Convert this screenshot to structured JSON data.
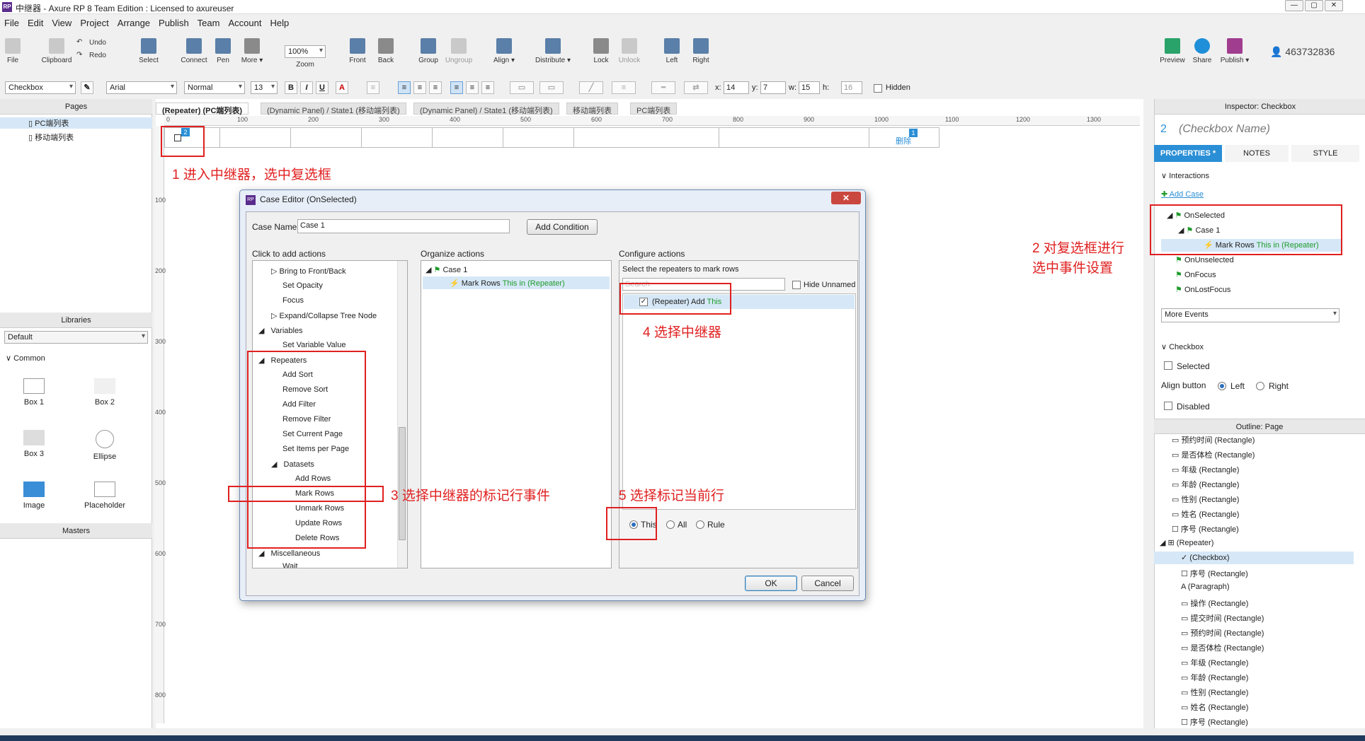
{
  "window": {
    "title": "中继器 - Axure RP 8 Team Edition : Licensed to axureuser",
    "logo": "RP"
  },
  "menu": [
    "File",
    "Edit",
    "View",
    "Project",
    "Arrange",
    "Publish",
    "Team",
    "Account",
    "Help"
  ],
  "toolbar": {
    "file": "File",
    "clipboard": "Clipboard",
    "undo": "Undo",
    "redo": "Redo",
    "select": "Select",
    "connect": "Connect",
    "pen": "Pen",
    "more": "More ▾",
    "zoom_value": "100%",
    "zoom": "Zoom",
    "front": "Front",
    "back": "Back",
    "group": "Group",
    "ungroup": "Ungroup",
    "align": "Align ▾",
    "distribute": "Distribute ▾",
    "lock": "Lock",
    "unlock": "Unlock",
    "left": "Left",
    "right": "Right",
    "preview": "Preview",
    "share": "Share",
    "publish": "Publish ▾",
    "user": "463732836"
  },
  "format": {
    "widget_type": "Checkbox",
    "font": "Arial",
    "weight": "Normal",
    "size": "13",
    "bold": "B",
    "italic": "I",
    "underline": "U",
    "x_label": "x:",
    "x": "14",
    "y_label": "y:",
    "y": "7",
    "w_label": "w:",
    "w": "15",
    "h_label": "h:",
    "h": "16",
    "hidden": "Hidden"
  },
  "pages_panel": {
    "title": "Pages",
    "items": [
      "PC端列表",
      "移动端列表"
    ]
  },
  "libraries": {
    "title": "Libraries",
    "selected": "Default",
    "group": "Common",
    "items": [
      "Box 1",
      "Box 2",
      "Box 3",
      "Ellipse",
      "Image",
      "Placeholder"
    ]
  },
  "masters": {
    "title": "Masters"
  },
  "tabs": [
    "(Repeater) (PC端列表)",
    "(Dynamic Panel) / State1 (移动端列表)",
    "(Dynamic Panel) / State1 (移动端列表)",
    "移动端列表",
    "PC端列表"
  ],
  "ruler_h": [
    "0",
    "100",
    "200",
    "300",
    "400",
    "500",
    "600",
    "700",
    "800",
    "900",
    "1000",
    "1100",
    "1200",
    "1300"
  ],
  "ruler_v": [
    "100",
    "200",
    "300",
    "400",
    "500",
    "600",
    "700",
    "800"
  ],
  "canvas": {
    "badge1": "2",
    "badge2": "1",
    "delete_text": "删除"
  },
  "annotations": {
    "a1": "1 进入中继器，选中复选框",
    "a2_line1": "2 对复选框进行",
    "a2_line2": "选中事件设置",
    "a3": "3 选择中继器的标记行事件",
    "a4": "4 选择中继器",
    "a5": "5 选择标记当前行"
  },
  "dialog": {
    "title": "Case Editor (OnSelected)",
    "close": "✕",
    "case_name_label": "Case Name",
    "case_name": "Case 1",
    "add_condition": "Add Condition",
    "col1_title": "Click to add actions",
    "col2_title": "Organize actions",
    "col3_title": "Configure actions",
    "actions": [
      "Bring to Front/Back",
      "Set Opacity",
      "Focus",
      "Expand/Collapse Tree Node",
      "Variables",
      "Set Variable Value",
      "Repeaters",
      "Add Sort",
      "Remove Sort",
      "Add Filter",
      "Remove Filter",
      "Set Current Page",
      "Set Items per Page",
      "Datasets",
      "Add Rows",
      "Mark Rows",
      "Unmark Rows",
      "Update Rows",
      "Delete Rows",
      "Miscellaneous",
      "Wait"
    ],
    "organize": {
      "case": "Case 1",
      "action": "Mark Rows",
      "action_green": "This in (Repeater)"
    },
    "configure": {
      "label": "Select the repeaters to mark rows",
      "search_placeholder": "Search",
      "hide_unnamed": "Hide Unnamed",
      "repeater_item": "(Repeater) Add",
      "repeater_green": "This",
      "opt_this": "This",
      "opt_all": "All",
      "opt_rule": "Rule"
    },
    "ok": "OK",
    "cancel": "Cancel"
  },
  "inspector": {
    "title": "Inspector: Checkbox",
    "number": "2",
    "name_placeholder": "(Checkbox Name)",
    "tabs": [
      "PROPERTIES",
      "NOTES",
      "STYLE"
    ],
    "interactions": "Interactions",
    "add_case": "Add Case",
    "events": [
      "OnSelected",
      "Case 1",
      "OnUnselected",
      "OnFocus",
      "OnLostFocus"
    ],
    "mark_rows": "Mark Rows",
    "mark_rows_green": "This in (Repeater)",
    "more_events": "More Events",
    "checkbox_section": "Checkbox",
    "selected": "Selected",
    "align_button": "Align button",
    "left": "Left",
    "right": "Right",
    "disabled": "Disabled"
  },
  "outline": {
    "title": "Outline: Page",
    "items": [
      "预约时间 (Rectangle)",
      "是否体检 (Rectangle)",
      "年级 (Rectangle)",
      "年龄 (Rectangle)",
      "性别 (Rectangle)",
      "姓名 (Rectangle)",
      "序号 (Rectangle)",
      "(Repeater)",
      "(Checkbox)",
      "序号 (Rectangle)",
      "(Paragraph)",
      "操作 (Rectangle)",
      "提交时间 (Rectangle)",
      "预约时间 (Rectangle)",
      "是否体检 (Rectangle)",
      "年级 (Rectangle)",
      "年龄 (Rectangle)",
      "性别 (Rectangle)",
      "姓名 (Rectangle)",
      "序号 (Rectangle)"
    ]
  },
  "colors": {
    "accent": "#2a8fd6",
    "annotation": "#e02020",
    "green": "#1e9a2a"
  }
}
